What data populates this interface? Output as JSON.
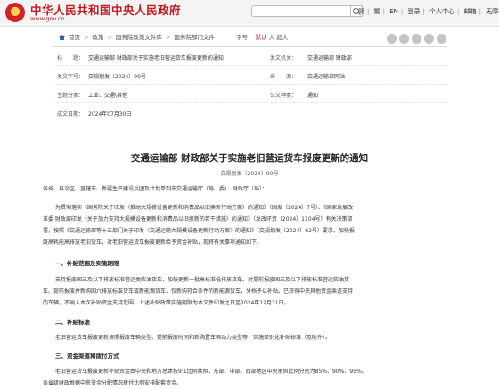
{
  "header": {
    "site_title": "中华人民共和国中央人民政府",
    "site_url": "www.gov.cn",
    "search_placeholder": "",
    "links": [
      "简",
      "繁",
      "EN",
      "登录",
      "个人中心",
      "邮箱",
      "无障碍"
    ]
  },
  "breadcrumb": {
    "items": [
      "首页",
      "政策",
      "国务院政策文件库",
      "国务院部门文件"
    ]
  },
  "font_size": {
    "label": "字号：",
    "options": [
      "默认",
      "大",
      "超大"
    ],
    "selected": "默认"
  },
  "meta": {
    "title_label": "标　　题：",
    "title_value": "交通运输部 财政部关于实施老旧营运货车报废更新的通知",
    "issuer_label": "发文机关：",
    "issuer_value": "交通运输部 财政部",
    "doc_no_label": "发文字号：",
    "doc_no_value": "交规划发〔2024〕90号",
    "source_label": "来　　源：",
    "source_value": "交通运输部网站",
    "topic_label": "主题分类：",
    "topic_value": "工业、交通\\其他",
    "type_label": "公文种类：",
    "type_value": "通知",
    "date_label": "成文日期：",
    "date_value": "2024年07月30日"
  },
  "doc": {
    "title": "交通运输部 财政部关于实施老旧营运货车报废更新的通知",
    "number": "交规划发〔2024〕90号",
    "salutation": "各省、自治区、直辖市、新疆生产建设兵团及计划单列市交通运输厅（局、委）、财政厅（局）：",
    "intro": [
      "为贯彻落实《国务院关于印发〈推动大规模设备更新和消费品以旧换新行动方案〉的通知》（国发〔2024〕7号）、《国家发展改",
      "革委 财政部印发〈关于加力支持大规模设备更新和消费品以旧换新的若干措施〉的通知》（发改环资〔2024〕1104号）有关决策部",
      "署，按照《交通运输部等十三部门关于印发〈交通运输大规模设备更新行动方案〉的通知》（交规划发〔2024〕62号）要求，加快报",
      "废高耗能高排放老旧货车，对老旧营运货车报废更新给予资金补贴，现将有关事项通知如下。"
    ],
    "s1_heading": "一、补贴范围及实施期限",
    "s1": [
      "支持报废国三及以下排放标准营运类柴油货车，加快更新一批高标准低排放货车。对提前报废国三及以下排放标准营运柴油货",
      "车、提前报废并新购国六排放标准货车或新能源货车、仅新购符合条件的新能源货车，分档予以补贴。已获得中央其他资金渠道支持",
      "的车辆，不纳入本次补贴资金支持范围。上述补贴政策实施期限为本文件印发之日至2024年12月31日。"
    ],
    "s2_heading": "二、补贴标准",
    "s2": [
      "老旧营运货车报废更新按照报废车辆类型、提前报废时间和新购置车辆动力类型等，实施差别化补贴标准（见附件）。"
    ],
    "s3_heading": "三、资金渠道和拨付方式",
    "s3": [
      "老旧营运货车报废更新补贴资金由中央和地方总体按9:1比例共担，东部、中部、西部地区中央承担比例分别为85%、90%、95%。",
      "各省级财政根据中央资金分配情况拨付比例安排配套资金。"
    ]
  }
}
